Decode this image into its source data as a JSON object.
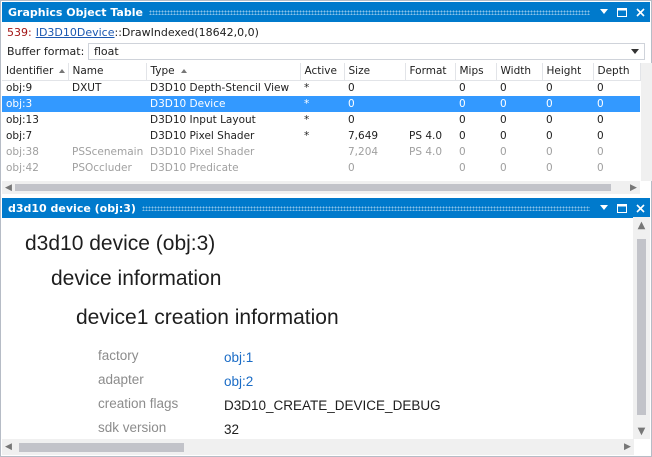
{
  "top_panel": {
    "title": "Graphics Object Table",
    "call": {
      "number": "539:",
      "object": "ID3D10Device",
      "method": "::DrawIndexed(18642,0,0)"
    },
    "buffer_format": {
      "label": "Buffer format:",
      "value": "float"
    },
    "columns": [
      "Identifier",
      "Name",
      "Type",
      "Active",
      "Size",
      "Format",
      "Mips",
      "Width",
      "Height",
      "Depth"
    ],
    "rows": [
      [
        "obj:9",
        "DXUT",
        "D3D10 Depth-Stencil View",
        "*",
        "0",
        "",
        "0",
        "0",
        "0",
        "0"
      ],
      [
        "obj:3",
        "",
        "D3D10 Device",
        "*",
        "0",
        "",
        "0",
        "0",
        "0",
        "0"
      ],
      [
        "obj:13",
        "",
        "D3D10 Input Layout",
        "*",
        "0",
        "",
        "0",
        "0",
        "0",
        "0"
      ],
      [
        "obj:7",
        "",
        "D3D10 Pixel Shader",
        "*",
        "7,649",
        "PS 4.0",
        "0",
        "0",
        "0",
        "0"
      ],
      [
        "obj:38",
        "PSScenemain",
        "D3D10 Pixel Shader",
        "",
        "7,204",
        "PS 4.0",
        "0",
        "0",
        "0",
        "0"
      ],
      [
        "obj:42",
        "PSOccluder",
        "D3D10 Predicate",
        "",
        "0",
        "",
        "0",
        "0",
        "0",
        "0"
      ]
    ],
    "selected_row": 1,
    "dim_rows": [
      4,
      5
    ]
  },
  "bottom_panel": {
    "title": "d3d10 device (obj:3)",
    "heading1": "d3d10 device (obj:3)",
    "heading2": "device information",
    "heading3": "device1 creation information",
    "properties": [
      {
        "label": "factory",
        "value": "obj:1",
        "is_link": true
      },
      {
        "label": "adapter",
        "value": "obj:2",
        "is_link": true
      },
      {
        "label": "creation flags",
        "value": "D3D10_CREATE_DEVICE_DEBUG",
        "is_link": false
      },
      {
        "label": "sdk version",
        "value": "32",
        "is_link": false
      }
    ]
  },
  "colors": {
    "title_bar": "#007acc",
    "selection": "#3399ff",
    "link": "#1a6cc6",
    "call_number": "#a31515"
  },
  "icons": [
    "dropdown-arrow-icon",
    "maximize-icon",
    "close-icon",
    "sort-ascending-icon",
    "scroll-left-icon",
    "scroll-right-icon",
    "scroll-up-icon",
    "scroll-down-icon"
  ]
}
